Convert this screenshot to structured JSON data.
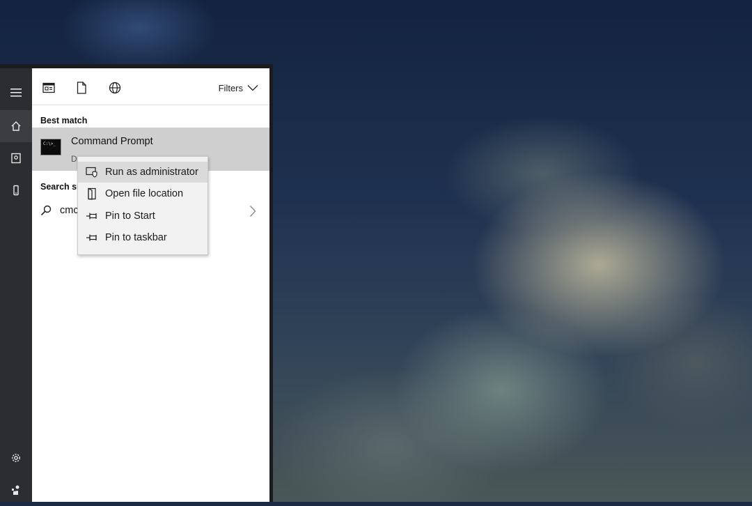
{
  "tabs": {
    "filters_label": "Filters"
  },
  "best_match": {
    "section_label": "Best match",
    "title": "Command Prompt",
    "subtitle": "D",
    "icon_text": "C:\\>_"
  },
  "suggestions": {
    "section_label": "Search su",
    "query_text": "cmc"
  },
  "context_menu": {
    "items": [
      {
        "label": "Run as administrator",
        "icon": "shield-window-icon"
      },
      {
        "label": "Open file location",
        "icon": "folder-open-icon"
      },
      {
        "label": "Pin to Start",
        "icon": "pin-icon"
      },
      {
        "label": "Pin to taskbar",
        "icon": "pin-icon"
      }
    ]
  },
  "colors": {
    "rail_bg": "#2b2d30",
    "panel_bg": "#ffffff",
    "selected_row": "#cfcfcf",
    "context_menu_bg": "#f2f2f2"
  }
}
